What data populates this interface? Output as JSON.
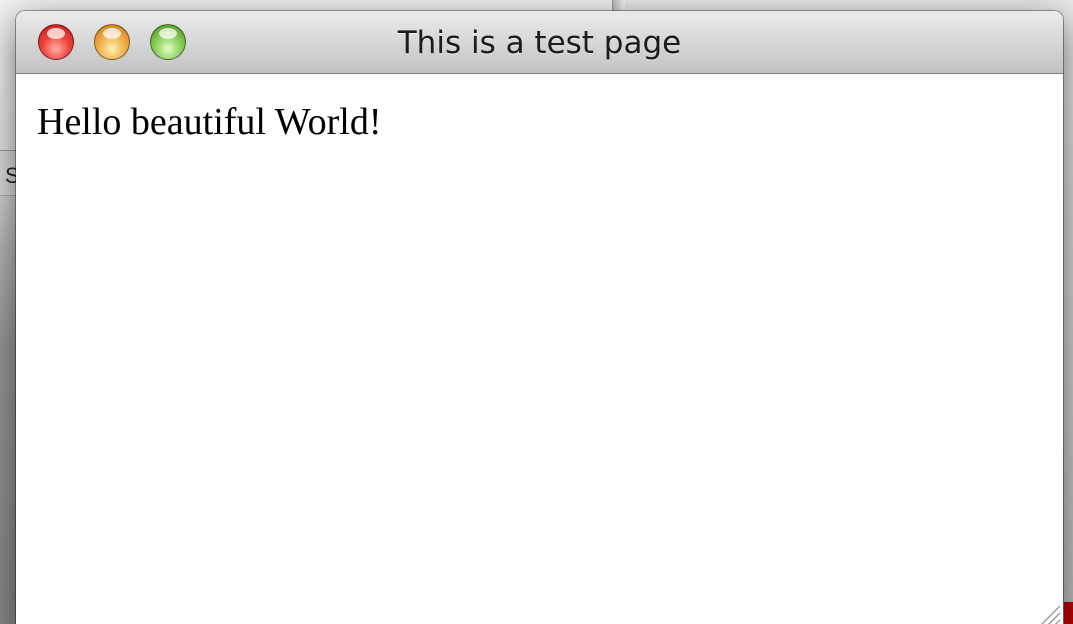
{
  "window": {
    "title": "This is a test page"
  },
  "content": {
    "text": "Hello beautiful World!"
  },
  "background": {
    "partial_text": "S"
  },
  "controls": {
    "close_color": "#e8423a",
    "minimize_color": "#f2ac42",
    "zoom_color": "#82c94f",
    "close_icon": "close-icon",
    "minimize_icon": "minimize-icon",
    "zoom_icon": "zoom-icon",
    "resize_icon": "resize-grip-icon"
  }
}
